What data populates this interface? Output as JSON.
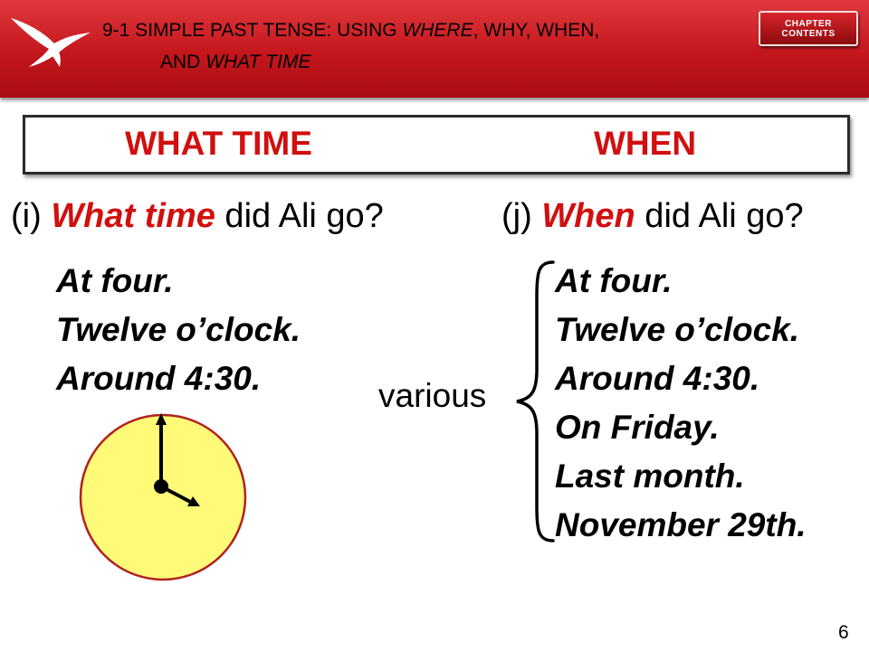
{
  "header": {
    "title_line1_prefix": "9-1  SIMPLE PAST TENSE: USING ",
    "title_line1_where": "WHERE",
    "title_line1_suffix": ", WHY, WHEN,",
    "title_line2_prefix": "AND ",
    "title_line2_italic": "WHAT TIME",
    "chapter_button": {
      "line1": "CHAPTER",
      "line2": "CONTENTS"
    }
  },
  "table_header": {
    "left": "WHAT TIME",
    "right": "WHEN"
  },
  "left_question": {
    "label": "(i) ",
    "emphasis": "What time",
    "rest": " did Ali go?"
  },
  "right_question": {
    "label": "(j) ",
    "emphasis": "When",
    "rest": " did Ali go?"
  },
  "left_answers": [
    "At four.",
    "Twelve o’clock.",
    "Around 4:30."
  ],
  "right_answers": [
    "At four.",
    "Twelve o’clock.",
    "Around 4:30.",
    "On Friday.",
    "Last month.",
    "November 29th."
  ],
  "various_label": "various",
  "page_number": "6",
  "colors": {
    "header_red": "#c4161c",
    "accent_red": "#d10f0f",
    "clock_face": "#fffa78"
  },
  "icons": {
    "logo": "swallow-bird-icon",
    "clock": "clock-icon",
    "brace": "curly-brace-icon"
  }
}
